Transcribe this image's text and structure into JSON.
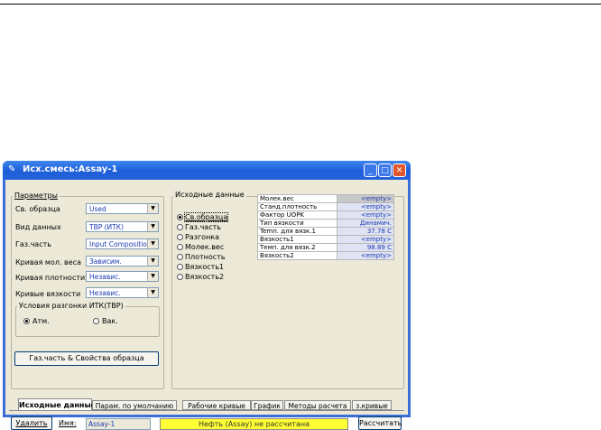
{
  "window": {
    "title": "Исх.смесь:Assay-1",
    "controls": {
      "minimize": "_",
      "maximize": "□",
      "close": "✕"
    }
  },
  "params": {
    "group_label": "Параметры",
    "rows": [
      {
        "label": "Св. образца",
        "value": "Used"
      },
      {
        "label": "Вид данных",
        "value": "TBP (ИТК)"
      },
      {
        "label": "Газ.часть",
        "value": "Input Composition"
      },
      {
        "label": "Кривая мол. веса",
        "value": "Зависим."
      },
      {
        "label": "Кривая плотности",
        "value": "Независ."
      },
      {
        "label": "Кривые вязкости",
        "value": "Независ."
      }
    ],
    "conditions": {
      "label": "Условия разгонки ИТК(ТВР)",
      "options": [
        {
          "label": "Атм.",
          "selected": true
        },
        {
          "label": "Вак.",
          "selected": false
        }
      ]
    },
    "props_button": "Газ.часть & Свойства образца"
  },
  "source": {
    "group_label": "Исходные данные",
    "options": [
      {
        "label": "Св.образца",
        "selected": true
      },
      {
        "label": "Газ.часть",
        "selected": false
      },
      {
        "label": "Разгонка",
        "selected": false
      },
      {
        "label": "Молек.вес",
        "selected": false
      },
      {
        "label": "Плотность",
        "selected": false
      },
      {
        "label": "Вязкость1",
        "selected": false
      },
      {
        "label": "Вязкость2",
        "selected": false
      }
    ],
    "table": [
      {
        "name": "Молек.вес",
        "value": "<empty>"
      },
      {
        "name": "Станд.плотность",
        "value": "<empty>"
      },
      {
        "name": "Фактор UOPK",
        "value": "<empty>"
      },
      {
        "name": "Тип вязкости",
        "value": "Динамич."
      },
      {
        "name": "Temп. для вязк.1",
        "value": "37.78 C"
      },
      {
        "name": "Вязкость1",
        "value": "<empty>"
      },
      {
        "name": "Темп. для вязк.2",
        "value": "98.89 C"
      },
      {
        "name": "Вязкость2",
        "value": "<empty>"
      }
    ]
  },
  "tabs": [
    {
      "label": "Исходные данные",
      "active": true
    },
    {
      "label": "Парам. по умолчанию",
      "active": false
    },
    {
      "label": "Рабочие кривые",
      "active": false
    },
    {
      "label": "График",
      "active": false
    },
    {
      "label": "Методы расчета",
      "active": false
    },
    {
      "label": "з.кривые",
      "active": false
    }
  ],
  "footer": {
    "delete_button": "Удалить",
    "name_label": "Имя:",
    "name_value": "Assay-1",
    "status": "Нефть (Assay) не рассчитана",
    "calc_button": "Рассчитать"
  }
}
